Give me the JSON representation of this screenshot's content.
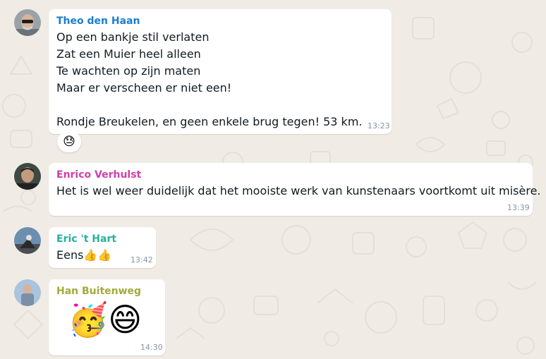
{
  "messages": [
    {
      "sender": "Theo den Haan",
      "sender_color": "#1a7ecf",
      "text": "Op een bankje stil verlaten\nZat een Muier heel alleen\nTe wachten op zijn maten\nMaar er verscheen er niet een!\n\nRondje Breukelen, en geen enkele brug tegen! 53 km.",
      "time": "13:23",
      "reaction": "😓"
    },
    {
      "sender": "Enrico Verhulst",
      "sender_color": "#d13fa8",
      "text": "Het is wel weer duidelijk dat het mooiste werk van kunstenaars voortkomt uit misère.",
      "time": "13:39"
    },
    {
      "sender": "Eric 't Hart",
      "sender_color": "#22b39a",
      "text": "Eens👍👍",
      "time": "13:42"
    },
    {
      "sender": "Han Buitenweg",
      "sender_color": "#a4a93a",
      "text": "🥳😄",
      "time": "14:30"
    }
  ]
}
